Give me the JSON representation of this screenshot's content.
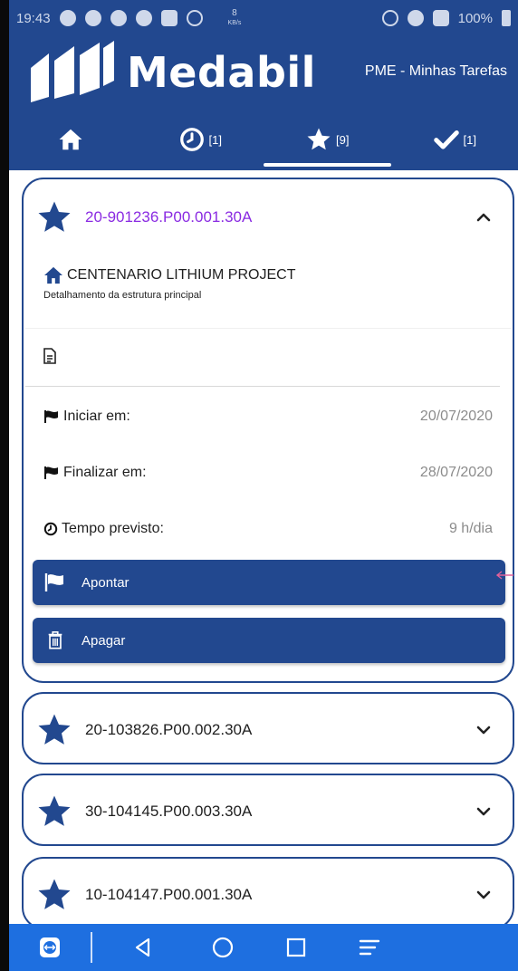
{
  "status_bar": {
    "time": "19:43",
    "speed": "8",
    "speed_unit": "KB/s",
    "battery": "100%"
  },
  "brand": {
    "name": "Medabil",
    "subtitle": "PME - Minhas Tarefas"
  },
  "tabs": [
    {
      "icon": "home-icon",
      "label": ""
    },
    {
      "icon": "clock-icon",
      "label": "[1]"
    },
    {
      "icon": "star-icon",
      "label": "[9]",
      "active": true
    },
    {
      "icon": "check-icon",
      "label": "[1]"
    }
  ],
  "expanded_task": {
    "code": "20-901236.P00.001.30A",
    "project": "CENTENARIO LITHIUM PROJECT",
    "description": "Detalhamento da estrutura principal",
    "start_label": "Iniciar em:",
    "start_value": "20/07/2020",
    "end_label": "Finalizar em:",
    "end_value": "28/07/2020",
    "time_label": "Tempo previsto:",
    "time_value": "9 h/dia",
    "point_button": "Apontar",
    "delete_button": "Apagar"
  },
  "tasks": [
    {
      "code": "20-103826.P00.002.30A"
    },
    {
      "code": "30-104145.P00.003.30A"
    },
    {
      "code": "10-104147.P00.001.30A"
    }
  ],
  "colors": {
    "primary": "#22488f",
    "accent_text": "#8a2be2",
    "nav": "#1e6fe0"
  }
}
